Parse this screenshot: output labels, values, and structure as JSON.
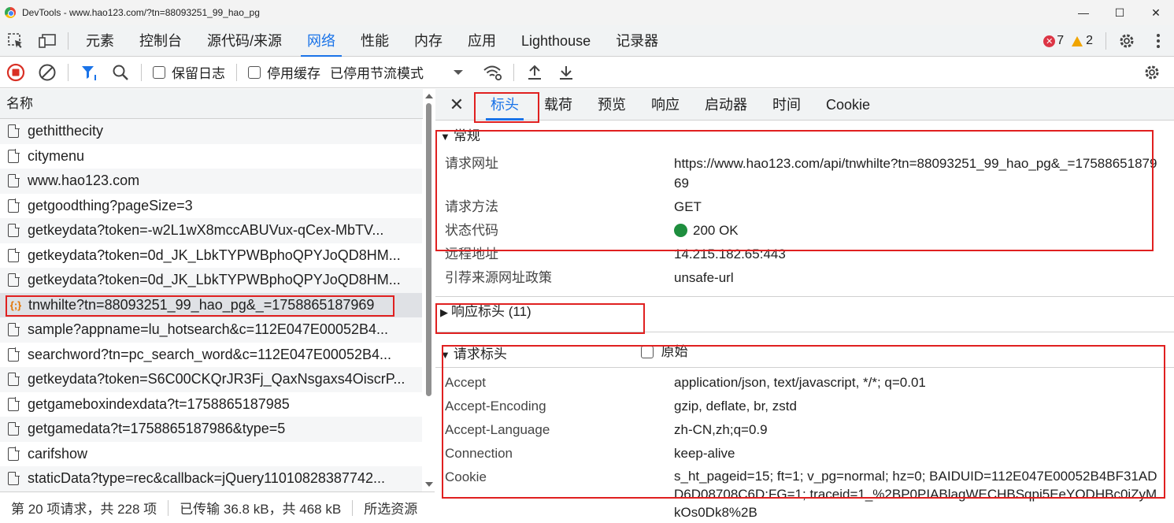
{
  "window": {
    "title": "DevTools - www.hao123.com/?tn=88093251_99_hao_pg"
  },
  "main_tabs": [
    "元素",
    "控制台",
    "源代码/来源",
    "网络",
    "性能",
    "内存",
    "应用",
    "Lighthouse",
    "记录器"
  ],
  "badges": {
    "errors": "7",
    "warnings": "2"
  },
  "toolbar": {
    "preserve_log": "保留日志",
    "disable_cache": "停用缓存",
    "throttling": "已停用节流模式"
  },
  "request_list": {
    "header": "名称",
    "items": [
      "gethitthecity",
      "citymenu",
      "www.hao123.com",
      "getgoodthing?pageSize=3",
      "getkeydata?token=-w2L1wX8mccABUVux-qCex-MbTV...",
      "getkeydata?token=0d_JK_LbkTYPWBphoQPYJoQD8HM...",
      "getkeydata?token=0d_JK_LbkTYPWBphoQPYJoQD8HM...",
      "tnwhilte?tn=88093251_99_hao_pg&_=1758865187969",
      "sample?appname=lu_hotsearch&c=112E047E00052B4...",
      "searchword?tn=pc_search_word&c=112E047E00052B4...",
      "getkeydata?token=S6C00CKQrJR3Fj_QaxNsgaxs4OiscrP...",
      "getgameboxindexdata?t=1758865187985",
      "getgamedata?t=1758865187986&type=5",
      "carifshow",
      "staticData?type=rec&callback=jQuery11010828387742..."
    ]
  },
  "status_bar": {
    "requests": "第 20 项请求，共 228 项",
    "transferred": "已传输 36.8 kB，共 468 kB",
    "selected": "所选资源"
  },
  "detail_tabs": [
    "标头",
    "载荷",
    "预览",
    "响应",
    "启动器",
    "时间",
    "Cookie"
  ],
  "general": {
    "title": "常规",
    "request_url_label": "请求网址",
    "request_url": "https://www.hao123.com/api/tnwhilte?tn=88093251_99_hao_pg&_=1758865187969",
    "method_label": "请求方法",
    "method": "GET",
    "status_label": "状态代码",
    "status": "200 OK",
    "remote_label": "远程地址",
    "remote": "14.215.182.65:443",
    "referrer_label": "引荐来源网址政策",
    "referrer": "unsafe-url"
  },
  "response_headers": {
    "title": "响应标头 (11)"
  },
  "request_headers": {
    "title": "请求标头",
    "raw": "原始",
    "rows": [
      {
        "k": "Accept",
        "v": "application/json, text/javascript, */*; q=0.01"
      },
      {
        "k": "Accept-Encoding",
        "v": "gzip, deflate, br, zstd"
      },
      {
        "k": "Accept-Language",
        "v": "zh-CN,zh;q=0.9"
      },
      {
        "k": "Connection",
        "v": "keep-alive"
      },
      {
        "k": "Cookie",
        "v": "s_ht_pageid=15; ft=1; v_pg=normal; hz=0; BAIDUID=112E047E00052B4BF31ADD6D08708C6D:FG=1; traceid=1_%2BP0PIABlagWECHBSqpi5EeYODHBc0iZyMkOs0Dk8%2B"
      }
    ]
  },
  "colors": {
    "accent": "#1a73e8",
    "status_ok": "#1e8e3e",
    "error": "#dc3545",
    "warning": "#f0a500",
    "highlight_box": "#e02020"
  }
}
